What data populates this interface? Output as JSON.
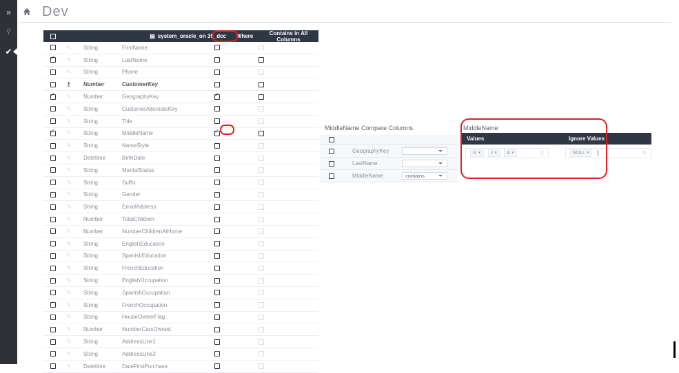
{
  "app": {
    "title": "Dev"
  },
  "rail": {
    "expand_icon": "»",
    "search_icon": "⚲",
    "active_icon": "✔"
  },
  "main": {
    "header": {
      "table_name": "system_oracle_on 35_dcc",
      "where": "Where",
      "contains": "Contains in All Columns"
    },
    "rows": [
      {
        "checked": false,
        "key": false,
        "type": "String",
        "name": "FirstName",
        "where": false,
        "contains": false,
        "contains_muted": true
      },
      {
        "checked": true,
        "key": false,
        "type": "String",
        "name": "LastName",
        "where": false,
        "contains": false,
        "contains_muted": false
      },
      {
        "checked": false,
        "key": false,
        "type": "String",
        "name": "Phone",
        "where": false,
        "contains": false,
        "contains_muted": true
      },
      {
        "checked": false,
        "key": true,
        "type": "Number",
        "name": "CustomerKey",
        "where": false,
        "contains": false,
        "contains_muted": false,
        "bold": true
      },
      {
        "checked": true,
        "key": false,
        "type": "Number",
        "name": "GeographyKey",
        "where": true,
        "contains": false,
        "contains_muted": false
      },
      {
        "checked": false,
        "key": false,
        "type": "String",
        "name": "CustomerAlternateKey",
        "where": false,
        "contains": false,
        "contains_muted": true
      },
      {
        "checked": false,
        "key": false,
        "type": "String",
        "name": "Title",
        "where": false,
        "contains": false,
        "contains_muted": true
      },
      {
        "checked": true,
        "key": false,
        "type": "String",
        "name": "MiddleName",
        "where": true,
        "contains": false,
        "contains_muted": false
      },
      {
        "checked": false,
        "key": false,
        "type": "String",
        "name": "NameStyle",
        "where": false,
        "contains": false,
        "contains_muted": true
      },
      {
        "checked": false,
        "key": false,
        "type": "Datetime",
        "name": "BirthDate",
        "where": false,
        "contains": false,
        "contains_muted": true
      },
      {
        "checked": false,
        "key": false,
        "type": "String",
        "name": "MaritalStatus",
        "where": false,
        "contains": false,
        "contains_muted": true
      },
      {
        "checked": false,
        "key": false,
        "type": "String",
        "name": "Suffix",
        "where": false,
        "contains": false,
        "contains_muted": true
      },
      {
        "checked": false,
        "key": false,
        "type": "String",
        "name": "Gender",
        "where": false,
        "contains": false,
        "contains_muted": true
      },
      {
        "checked": false,
        "key": false,
        "type": "String",
        "name": "EmailAddress",
        "where": false,
        "contains": false,
        "contains_muted": true
      },
      {
        "checked": false,
        "key": false,
        "type": "Number",
        "name": "TotalChildren",
        "where": false,
        "contains": false,
        "contains_muted": true
      },
      {
        "checked": false,
        "key": false,
        "type": "Number",
        "name": "NumberChildrenAtHome",
        "where": false,
        "contains": false,
        "contains_muted": true
      },
      {
        "checked": false,
        "key": false,
        "type": "String",
        "name": "EnglishEducation",
        "where": false,
        "contains": false,
        "contains_muted": true
      },
      {
        "checked": false,
        "key": false,
        "type": "String",
        "name": "SpanishEducation",
        "where": false,
        "contains": false,
        "contains_muted": true
      },
      {
        "checked": false,
        "key": false,
        "type": "String",
        "name": "FrenchEducation",
        "where": false,
        "contains": false,
        "contains_muted": true
      },
      {
        "checked": false,
        "key": false,
        "type": "String",
        "name": "EnglishOccupation",
        "where": false,
        "contains": false,
        "contains_muted": true
      },
      {
        "checked": false,
        "key": false,
        "type": "String",
        "name": "SpanishOccupation",
        "where": false,
        "contains": false,
        "contains_muted": true
      },
      {
        "checked": false,
        "key": false,
        "type": "String",
        "name": "FrenchOccupation",
        "where": false,
        "contains": false,
        "contains_muted": true
      },
      {
        "checked": false,
        "key": false,
        "type": "String",
        "name": "HouseOwnerFlag",
        "where": false,
        "contains": false,
        "contains_muted": true
      },
      {
        "checked": false,
        "key": false,
        "type": "Number",
        "name": "NumberCarsOwned",
        "where": false,
        "contains": false,
        "contains_muted": true
      },
      {
        "checked": false,
        "key": false,
        "type": "String",
        "name": "AddressLine1",
        "where": false,
        "contains": false,
        "contains_muted": true
      },
      {
        "checked": false,
        "key": false,
        "type": "String",
        "name": "AddressLine2",
        "where": false,
        "contains": false,
        "contains_muted": true
      },
      {
        "checked": false,
        "key": false,
        "type": "Datetime",
        "name": "DateFirstPurchase",
        "where": false,
        "contains": false,
        "contains_muted": true
      }
    ]
  },
  "compare": {
    "title": "MiddleName Compare Columns",
    "rows": [
      {
        "label": "GeographyKey",
        "value": ""
      },
      {
        "label": "LastName",
        "value": ""
      },
      {
        "label": "MiddleName",
        "value": "contains"
      }
    ]
  },
  "middle": {
    "title": "MiddleName",
    "values_header": "Values",
    "ignore_header": "Ignore Values",
    "values": [
      "G",
      "J",
      "A"
    ],
    "ignore_values": [
      "NULL"
    ]
  },
  "colors": {
    "header": "#2f3644",
    "highlight": "#e02020",
    "rail": "#2f3136"
  }
}
